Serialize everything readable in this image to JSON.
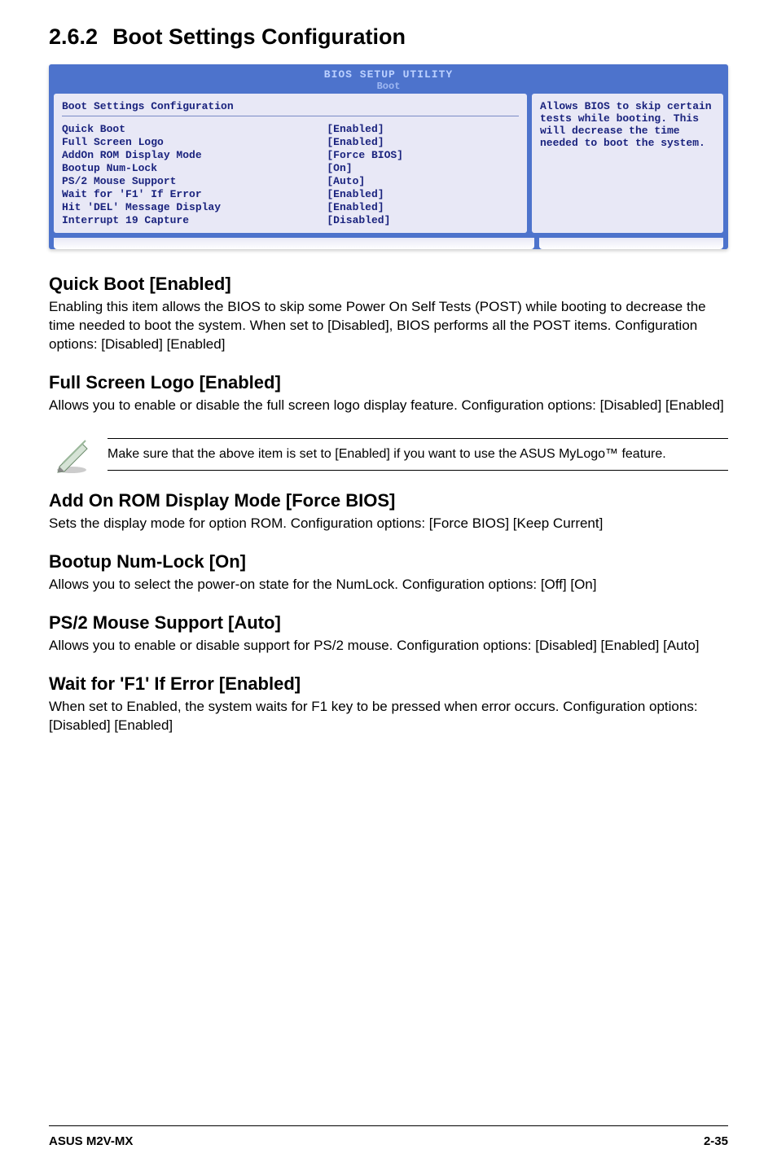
{
  "title": {
    "num": "2.6.2",
    "text": "Boot Settings Configuration"
  },
  "bios": {
    "header1": "BIOS SETUP UTILITY",
    "header2": "Boot",
    "panel_title": "Boot Settings Configuration",
    "rows": [
      {
        "label": "Quick Boot",
        "value": "[Enabled]"
      },
      {
        "label": "Full Screen Logo",
        "value": "[Enabled]"
      },
      {
        "label": "AddOn ROM Display Mode",
        "value": "[Force BIOS]"
      },
      {
        "label": "Bootup Num-Lock",
        "value": "[On]"
      },
      {
        "label": "PS/2 Mouse Support",
        "value": "[Auto]"
      },
      {
        "label": "Wait for 'F1' If Error",
        "value": "[Enabled]"
      },
      {
        "label": "Hit 'DEL' Message Display",
        "value": "[Enabled]"
      },
      {
        "label": "Interrupt 19 Capture",
        "value": "[Disabled]"
      }
    ],
    "help": "Allows BIOS to skip certain tests while booting. This will decrease the time needed to boot the system."
  },
  "sections": {
    "quickboot": {
      "heading": "Quick Boot [Enabled]",
      "body": "Enabling this item allows the BIOS to skip some Power On Self Tests (POST) while booting to decrease the time needed to boot the system. When set to [Disabled], BIOS performs all the POST items. Configuration options: [Disabled] [Enabled]"
    },
    "fullscreen": {
      "heading": "Full Screen Logo [Enabled]",
      "body": "Allows you to enable or disable the full screen logo display feature. Configuration options: [Disabled] [Enabled]"
    },
    "note": "Make sure that the above item is set to [Enabled] if you want to use the ASUS MyLogo™ feature.",
    "addon": {
      "heading": "Add On ROM Display Mode [Force BIOS]",
      "body": "Sets the display mode for option ROM. Configuration options: [Force BIOS] [Keep Current]"
    },
    "numlock": {
      "heading": "Bootup Num-Lock [On]",
      "body": "Allows you to select the power-on state for the NumLock. Configuration options: [Off] [On]"
    },
    "ps2": {
      "heading": "PS/2 Mouse Support [Auto]",
      "body": "Allows you to enable or disable support for PS/2 mouse. Configuration options: [Disabled] [Enabled] [Auto]"
    },
    "waitf1": {
      "heading": "Wait for 'F1' If Error [Enabled]",
      "body": "When set to Enabled, the system waits for F1 key to be pressed when error occurs. Configuration options: [Disabled] [Enabled]"
    }
  },
  "footer": {
    "left": "ASUS M2V-MX",
    "right": "2-35"
  }
}
